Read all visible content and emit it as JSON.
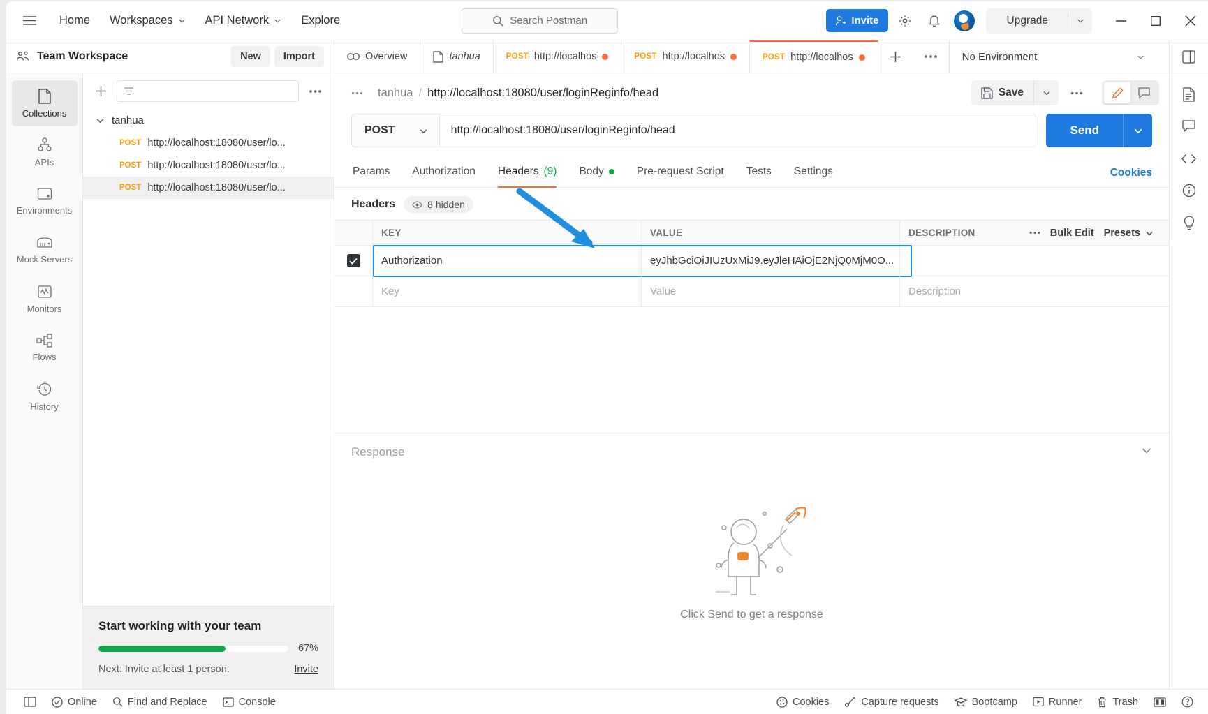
{
  "topbar": {
    "menu_icon": "hamburger-icon",
    "nav": [
      {
        "label": "Home",
        "caret": false
      },
      {
        "label": "Workspaces",
        "caret": true
      },
      {
        "label": "API Network",
        "caret": true
      },
      {
        "label": "Explore",
        "caret": false
      }
    ],
    "search_placeholder": "Search Postman",
    "invite_label": "Invite",
    "settings_icon": "gear-icon",
    "notifications_icon": "bell-icon",
    "avatar": "user-avatar",
    "upgrade_label": "Upgrade",
    "window_minimize": "minimize-icon",
    "window_maximize": "maximize-icon",
    "window_close": "close-icon"
  },
  "workspace": {
    "name": "Team Workspace",
    "new_label": "New",
    "import_label": "Import"
  },
  "tabs": {
    "items": [
      {
        "type": "overview",
        "label": "Overview",
        "icon": "overview-icon",
        "method": "",
        "dirty": false,
        "active": false,
        "italic": false
      },
      {
        "type": "collection",
        "label": "tanhua",
        "icon": "collection-icon",
        "method": "",
        "dirty": false,
        "active": false,
        "italic": true
      },
      {
        "type": "request",
        "label": "http://localhos",
        "icon": "",
        "method": "POST",
        "dirty": true,
        "active": false,
        "italic": false
      },
      {
        "type": "request",
        "label": "http://localhos",
        "icon": "",
        "method": "POST",
        "dirty": true,
        "active": false,
        "italic": false
      },
      {
        "type": "request",
        "label": "http://localhos",
        "icon": "",
        "method": "POST",
        "dirty": true,
        "active": true,
        "italic": false
      }
    ],
    "new_tab_icon": "plus-icon",
    "more_icon": "ellipsis-icon",
    "environment": "No Environment"
  },
  "left_rail": [
    {
      "label": "Collections",
      "icon": "collections-icon",
      "active": true
    },
    {
      "label": "APIs",
      "icon": "apis-icon",
      "active": false
    },
    {
      "label": "Environments",
      "icon": "environments-icon",
      "active": false
    },
    {
      "label": "Mock Servers",
      "icon": "mock-servers-icon",
      "active": false
    },
    {
      "label": "Monitors",
      "icon": "monitors-icon",
      "active": false
    },
    {
      "label": "Flows",
      "icon": "flows-icon",
      "active": false
    },
    {
      "label": "History",
      "icon": "history-icon",
      "active": false
    }
  ],
  "sidebar": {
    "add_icon": "plus-icon",
    "filter_icon": "filter-icon",
    "more_icon": "ellipsis-icon",
    "filter_placeholder": "",
    "collection": {
      "name": "tanhua",
      "expanded": true
    },
    "requests": [
      {
        "method": "POST",
        "label": "http://localhost:18080/user/lo...",
        "selected": false
      },
      {
        "method": "POST",
        "label": "http://localhost:18080/user/lo...",
        "selected": false
      },
      {
        "method": "POST",
        "label": "http://localhost:18080/user/lo...",
        "selected": true
      }
    ],
    "onboarding": {
      "title": "Start working with your team",
      "progress_pct": "67%",
      "progress_value": 67,
      "next_text": "Next: Invite at least 1 person.",
      "invite_link": "Invite"
    }
  },
  "request": {
    "breadcrumb_collection": "tanhua",
    "breadcrumb_separator": "/",
    "breadcrumb_name": "http://localhost:18080/user/loginReginfo/head",
    "save_label": "Save",
    "save_icon": "save-icon",
    "more_icon": "ellipsis-icon",
    "comment_icon": "comment-icon",
    "edit_icon": "pencil-icon",
    "method": "POST",
    "url": "http://localhost:18080/user/loginReginfo/head",
    "send_label": "Send",
    "tabs": [
      {
        "label": "Params",
        "count": "",
        "dot": false,
        "active": false
      },
      {
        "label": "Authorization",
        "count": "",
        "dot": false,
        "active": false
      },
      {
        "label": "Headers",
        "count": "(9)",
        "dot": false,
        "active": true
      },
      {
        "label": "Body",
        "count": "",
        "dot": true,
        "active": false
      },
      {
        "label": "Pre-request Script",
        "count": "",
        "dot": false,
        "active": false
      },
      {
        "label": "Tests",
        "count": "",
        "dot": false,
        "active": false
      },
      {
        "label": "Settings",
        "count": "",
        "dot": false,
        "active": false
      }
    ],
    "cookies_link": "Cookies",
    "headers_section": {
      "label": "Headers",
      "hidden_pill": "8 hidden",
      "hidden_icon": "eye-icon",
      "columns": [
        "KEY",
        "VALUE",
        "DESCRIPTION"
      ],
      "bulk_edit_label": "Bulk Edit",
      "presets_label": "Presets",
      "more_icon": "ellipsis-icon",
      "rows": [
        {
          "checked": true,
          "key": "Authorization",
          "value": "eyJhbGciOiJIUzUxMiJ9.eyJleHAiOjE2NjQ0MjM0O...",
          "description": "",
          "highlighted": true
        }
      ],
      "empty_row": {
        "key": "Key",
        "value": "Value",
        "description": "Description"
      }
    }
  },
  "response": {
    "title": "Response",
    "empty_caption": "Click Send to get a response",
    "collapse_icon": "chevron-down-icon"
  },
  "right_rail": [
    {
      "icon": "layout-icon"
    },
    {
      "icon": "documentation-icon"
    },
    {
      "icon": "comments-icon"
    },
    {
      "icon": "code-icon"
    },
    {
      "icon": "info-icon"
    },
    {
      "icon": "lightbulb-icon"
    }
  ],
  "statusbar": {
    "left": [
      {
        "label": "",
        "icon": "sidebar-toggle-icon"
      },
      {
        "label": "Online",
        "icon": "online-icon"
      },
      {
        "label": "Find and Replace",
        "icon": "search-icon"
      },
      {
        "label": "Console",
        "icon": "console-icon"
      }
    ],
    "right": [
      {
        "label": "Cookies",
        "icon": "cookie-icon"
      },
      {
        "label": "Capture requests",
        "icon": "capture-icon"
      },
      {
        "label": "Bootcamp",
        "icon": "bootcamp-icon"
      },
      {
        "label": "Runner",
        "icon": "runner-icon"
      },
      {
        "label": "Trash",
        "icon": "trash-icon"
      },
      {
        "label": "",
        "icon": "panes-icon"
      },
      {
        "label": "",
        "icon": "help-icon"
      }
    ]
  },
  "colors": {
    "accent": "#ff6c37",
    "blue": "#1f7ae0",
    "green": "#11a64a",
    "annotation": "#1f8fe0"
  }
}
